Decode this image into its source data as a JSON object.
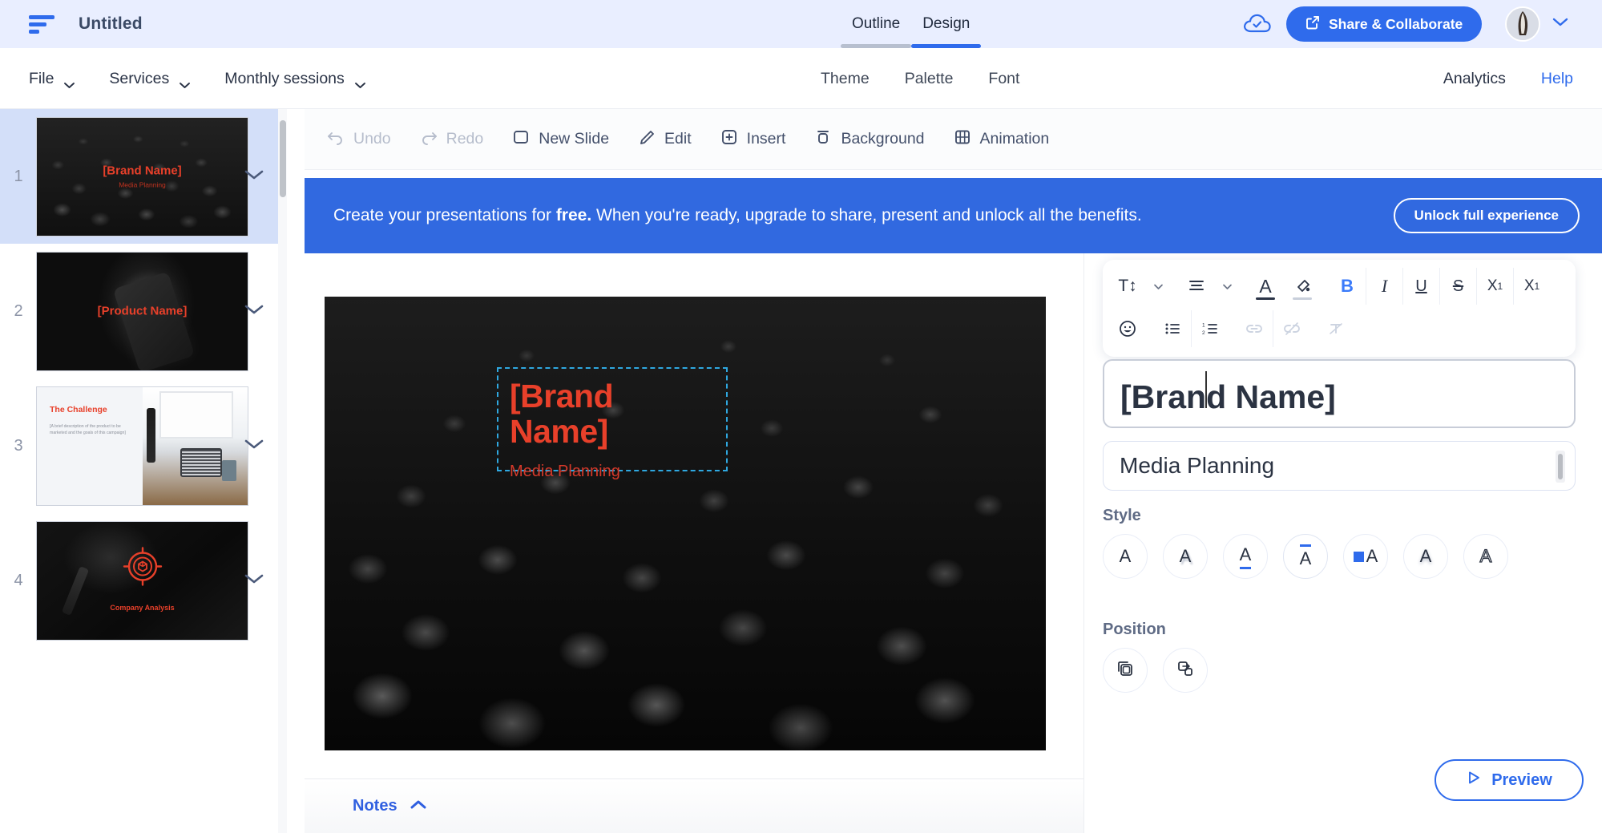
{
  "header": {
    "logo_icon": "logo-bars-icon",
    "doc_title": "Untitled",
    "tabs": [
      {
        "label": "Outline",
        "active": false
      },
      {
        "label": "Design",
        "active": true
      }
    ],
    "cloud_icon": "cloud-check-icon",
    "share_button": "Share & Collaborate",
    "share_icon": "external-link-icon",
    "avatar_caret_icon": "chevron-down-icon",
    "accent_color": "#2f6bec",
    "header_bg": "#e9eeff"
  },
  "menubar": {
    "left": [
      {
        "label": "File",
        "icon": "chevron-down-icon"
      },
      {
        "label": "Services",
        "icon": "chevron-down-icon"
      },
      {
        "label": "Monthly sessions",
        "icon": "chevron-down-icon"
      }
    ],
    "center": [
      {
        "label": "Theme"
      },
      {
        "label": "Palette"
      },
      {
        "label": "Font"
      }
    ],
    "right": [
      {
        "label": "Analytics",
        "color": "#2a3346"
      },
      {
        "label": "Help",
        "color": "#2f6bec"
      }
    ]
  },
  "toolbar": {
    "items": [
      {
        "label": "Undo",
        "icon": "undo-arrow-icon",
        "disabled": true
      },
      {
        "label": "Redo",
        "icon": "redo-arrow-icon",
        "disabled": true
      },
      {
        "label": "New Slide",
        "icon": "new-slide-icon",
        "disabled": false
      },
      {
        "label": "Edit",
        "icon": "pencil-icon",
        "disabled": false
      },
      {
        "label": "Insert",
        "icon": "plus-square-icon",
        "disabled": false
      },
      {
        "label": "Background",
        "icon": "background-icon",
        "disabled": false
      },
      {
        "label": "Animation",
        "icon": "animation-grid-icon",
        "disabled": false
      }
    ]
  },
  "banner": {
    "text_before": "Create your presentations for ",
    "text_bold": "free.",
    "text_after": " When you're ready, upgrade to share, present and unlock all the benefits.",
    "button": "Unlock full experience",
    "bg_color": "#3169e0"
  },
  "sidebar": {
    "slides": [
      {
        "number": "1",
        "title": "[Brand Name]",
        "subtitle": "Media Planning",
        "selected": true,
        "caret_icon": "chevron-down-icon"
      },
      {
        "number": "2",
        "title": "[Product Name]",
        "subtitle": "",
        "selected": false,
        "caret_icon": "chevron-down-icon"
      },
      {
        "number": "3",
        "title": "The Challenge",
        "subtitle": "[A brief description of the product to be marketed and the goals of this campaign]",
        "selected": false,
        "caret_icon": "chevron-down-icon"
      },
      {
        "number": "4",
        "title": "Company Analysis",
        "subtitle": "",
        "selected": false,
        "caret_icon": "chevron-down-icon"
      }
    ]
  },
  "slide_canvas": {
    "title": "[Brand Name]",
    "subtitle": "Media Planning",
    "text_color": "#e8402a",
    "selection_color": "#2fa8e0"
  },
  "notes": {
    "label": "Notes",
    "caret_icon": "chevron-up-icon"
  },
  "right_panel": {
    "format_toolbar_row1": [
      {
        "name": "text-size-icon",
        "glyph": "T↕",
        "state": "normal",
        "has_caret": true
      },
      {
        "name": "text-align-icon",
        "glyph": "≡",
        "state": "normal",
        "has_caret": true
      },
      {
        "name": "font-color-icon",
        "glyph": "A",
        "state": "underline-dark"
      },
      {
        "name": "highlight-color-icon",
        "glyph": "◢",
        "state": "underline-fill"
      },
      {
        "name": "bold-icon",
        "glyph": "B",
        "state": "active"
      },
      {
        "name": "italic-icon",
        "glyph": "I",
        "state": "normal"
      },
      {
        "name": "underline-icon",
        "glyph": "U",
        "state": "normal"
      },
      {
        "name": "strikethrough-icon",
        "glyph": "S",
        "state": "normal"
      },
      {
        "name": "subscript-icon",
        "glyph": "X₁",
        "state": "normal"
      },
      {
        "name": "superscript-icon",
        "glyph": "X¹",
        "state": "normal"
      }
    ],
    "format_toolbar_row2": [
      {
        "name": "emoji-icon",
        "glyph": "☺",
        "state": "normal"
      },
      {
        "name": "bulleted-list-icon",
        "glyph": "≣",
        "state": "normal"
      },
      {
        "name": "numbered-list-icon",
        "glyph": "1≣",
        "state": "normal"
      },
      {
        "name": "insert-link-icon",
        "glyph": "🔗",
        "state": "dim"
      },
      {
        "name": "remove-link-icon",
        "glyph": "🔗",
        "state": "dim"
      },
      {
        "name": "clear-format-icon",
        "glyph": "T̶",
        "state": "dim"
      }
    ],
    "title_field_value": "[Brand Name]",
    "subtitle_field_value": "Media Planning",
    "style_label": "Style",
    "style_options": [
      {
        "name": "style-plain",
        "glyph": "A"
      },
      {
        "name": "style-shadow",
        "glyph": "A"
      },
      {
        "name": "style-underline",
        "glyph": "A"
      },
      {
        "name": "style-overline",
        "glyph": "A",
        "selected": true
      },
      {
        "name": "style-highlight",
        "glyph": "A"
      },
      {
        "name": "style-soft-shadow",
        "glyph": "A"
      },
      {
        "name": "style-outline",
        "glyph": "A"
      }
    ],
    "position_label": "Position",
    "position_options": [
      {
        "name": "bring-to-front-icon"
      },
      {
        "name": "send-to-back-icon"
      }
    ],
    "preview_button": "Preview",
    "preview_icon": "play-triangle-icon"
  }
}
